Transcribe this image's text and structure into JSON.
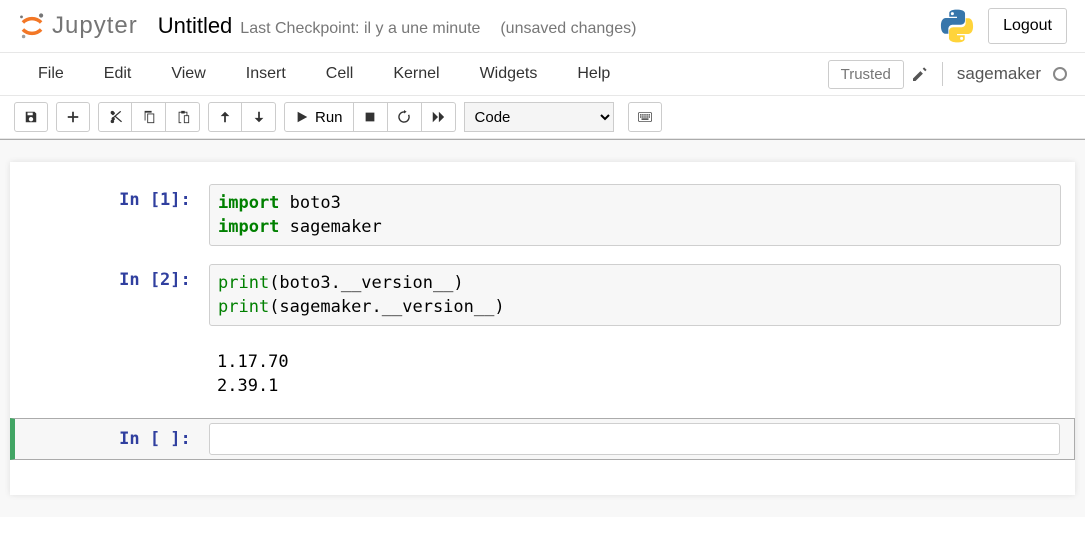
{
  "header": {
    "logo_text": "Jupyter",
    "title": "Untitled",
    "checkpoint_prefix": "Last Checkpoint:",
    "checkpoint_time": "il y a une minute",
    "unsaved": "(unsaved changes)",
    "logout": "Logout"
  },
  "menu": {
    "items": [
      "File",
      "Edit",
      "View",
      "Insert",
      "Cell",
      "Kernel",
      "Widgets",
      "Help"
    ],
    "trusted": "Trusted",
    "kernel_name": "sagemaker"
  },
  "toolbar": {
    "run_label": "Run",
    "celltype_selected": "Code"
  },
  "cells": [
    {
      "prompt": "In [1]: ",
      "code_tokens": [
        {
          "t": "import",
          "c": "kw"
        },
        {
          "t": " boto3\n"
        },
        {
          "t": "import",
          "c": "kw"
        },
        {
          "t": " sagemaker"
        }
      ]
    },
    {
      "prompt": "In [2]: ",
      "code_tokens": [
        {
          "t": "print",
          "c": "builtin"
        },
        {
          "t": "(boto3.__version__)\n"
        },
        {
          "t": "print",
          "c": "builtin"
        },
        {
          "t": "(sagemaker.__version__)"
        }
      ],
      "output": "1.17.70\n2.39.1"
    },
    {
      "prompt": "In [ ]: ",
      "empty": true
    }
  ]
}
